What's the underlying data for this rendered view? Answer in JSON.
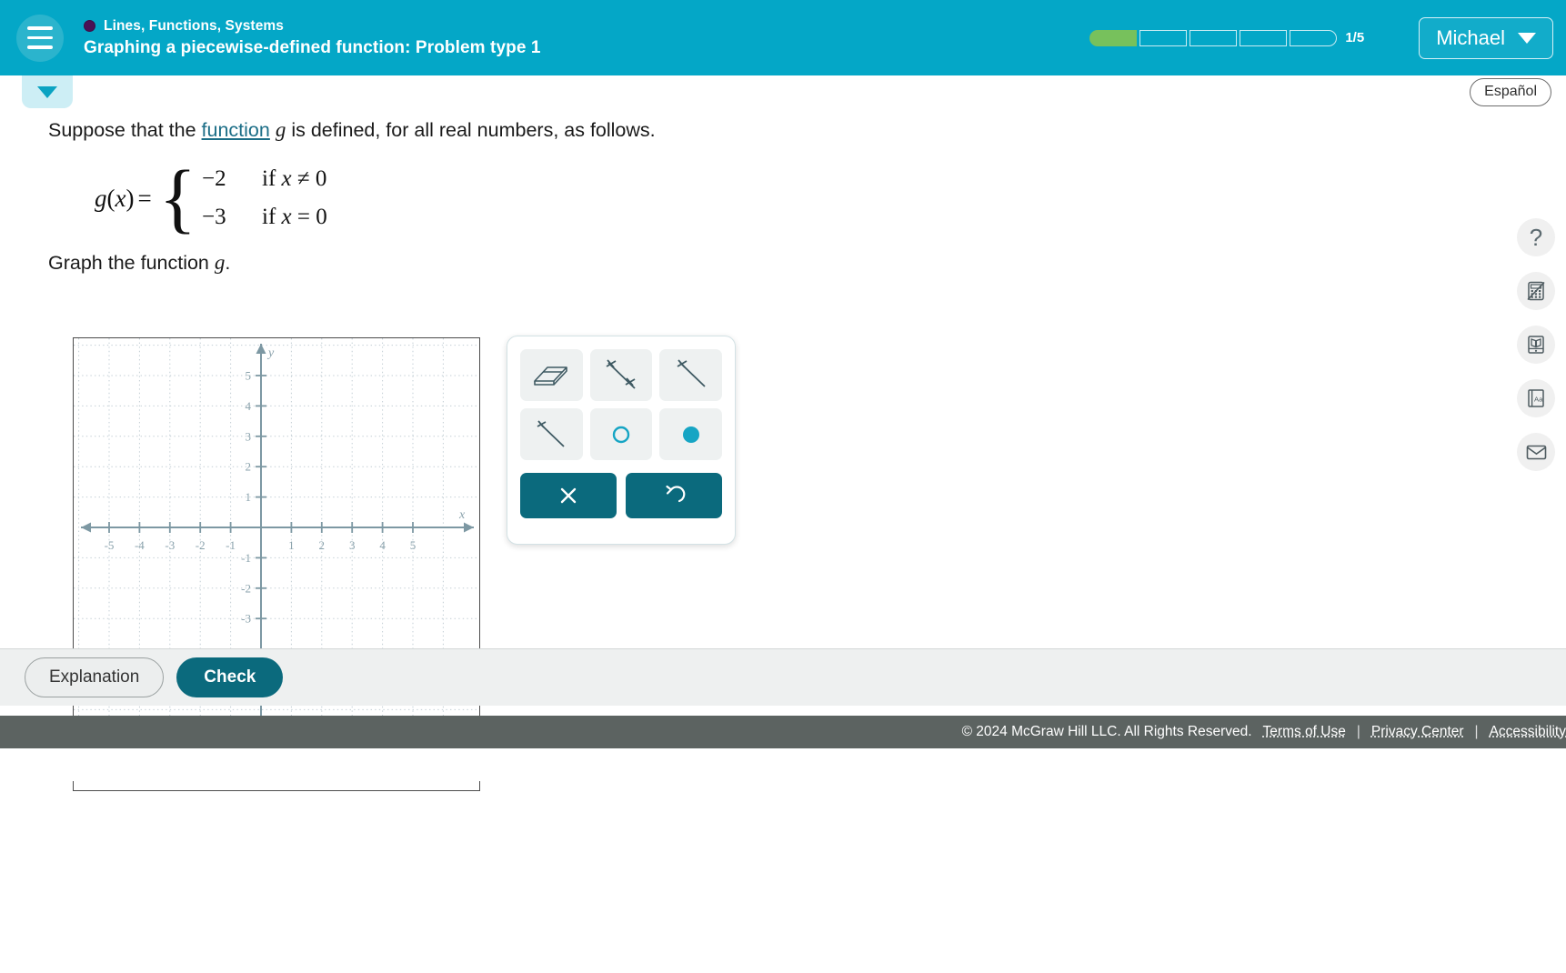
{
  "header": {
    "menu_icon": "hamburger-icon",
    "topic": "Lines, Functions, Systems",
    "title": "Graphing a piecewise-defined function: Problem type 1",
    "progress": {
      "label": "1/5",
      "total_segments": 5,
      "filled_segments": 1,
      "fill_color": "#77c15c"
    },
    "user": {
      "name": "Michael",
      "chevron_icon": "chevron-down-icon"
    },
    "background_color": "#04a7c7"
  },
  "subheader": {
    "collapse_icon": "chevron-down-icon",
    "espanol_label": "Español"
  },
  "problem": {
    "prompt_before_link": "Suppose that the ",
    "prompt_link": "function",
    "prompt_after_link": " is defined, for all real numbers, as follows.",
    "prompt_variable": "g",
    "equation": {
      "lhs_function": "g",
      "lhs_variable": "x",
      "equals": "=",
      "cases": [
        {
          "value": "−2",
          "condition_prefix": "if ",
          "condition_var": "x",
          "condition_rest": " ≠ 0"
        },
        {
          "value": "−3",
          "condition_prefix": "if ",
          "condition_var": "x",
          "condition_rest": " = 0"
        }
      ]
    },
    "instruction_text": "Graph the function ",
    "instruction_variable": "g",
    "instruction_period": "."
  },
  "chart_data": {
    "type": "scatter",
    "title": "",
    "xlabel": "x",
    "ylabel": "y",
    "xlim": [
      -5.6,
      5.6
    ],
    "ylim": [
      -3.4,
      5.9
    ],
    "xticks": [
      -5,
      -4,
      -3,
      -2,
      -1,
      1,
      2,
      3,
      4,
      5
    ],
    "yticks": [
      -3,
      -2,
      -1,
      1,
      2,
      3,
      4,
      5
    ],
    "xtick_labels": [
      "-5",
      "-4",
      "-3",
      "-2",
      "-1",
      "1",
      "2",
      "3",
      "4",
      "5"
    ],
    "ytick_labels": [
      "-3",
      "-2",
      "-1",
      "1",
      "2",
      "3",
      "4",
      "5"
    ],
    "grid": true,
    "grid_style": "dotted",
    "axis_color": "#7d98a3",
    "grid_color": "#b9c6cc",
    "series": [],
    "annotations": []
  },
  "palette": {
    "tools": [
      {
        "name": "eraser-tool",
        "icon": "eraser-icon"
      },
      {
        "name": "line-tool",
        "icon": "line-two-endpoints-icon"
      },
      {
        "name": "ray-tool",
        "icon": "ray-icon"
      },
      {
        "name": "segment-tool",
        "icon": "segment-icon"
      },
      {
        "name": "open-point-tool",
        "icon": "open-circle-icon"
      },
      {
        "name": "closed-point-tool",
        "icon": "filled-circle-icon"
      }
    ],
    "actions": [
      {
        "name": "clear-button",
        "icon": "x-icon"
      },
      {
        "name": "undo-button",
        "icon": "undo-arrow-icon"
      }
    ],
    "accent_color": "#0b6a7d",
    "point_color": "#16a5c4"
  },
  "rail": {
    "items": [
      {
        "name": "help-button",
        "icon": "question-mark-icon"
      },
      {
        "name": "calculator-button",
        "icon": "calculator-disabled-icon"
      },
      {
        "name": "reference-button",
        "icon": "open-book-icon"
      },
      {
        "name": "dictionary-button",
        "icon": "dictionary-aa-icon",
        "glyph": "Aa"
      },
      {
        "name": "message-button",
        "icon": "envelope-icon"
      }
    ]
  },
  "action_bar": {
    "explanation_label": "Explanation",
    "check_label": "Check"
  },
  "footer": {
    "copyright": "© 2024 McGraw Hill LLC. All Rights Reserved.",
    "links": [
      "Terms of Use",
      "Privacy Center",
      "Accessibility"
    ],
    "separator": "|",
    "background_color": "#5c6361"
  }
}
